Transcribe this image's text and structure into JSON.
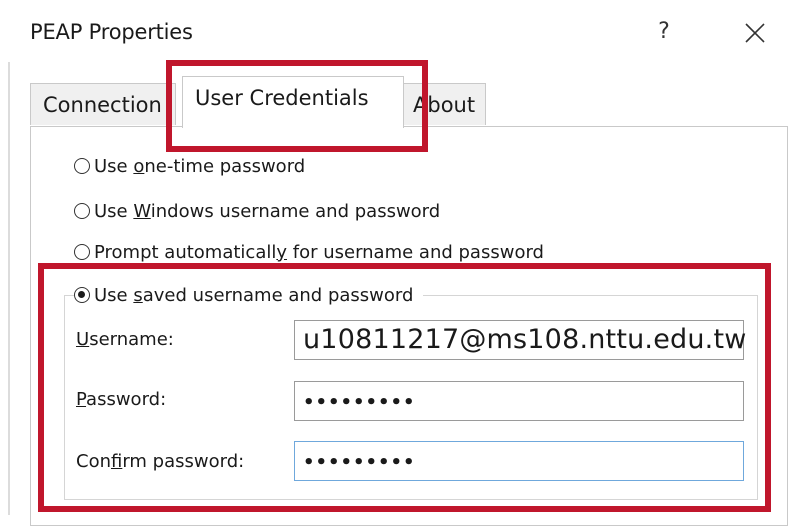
{
  "window": {
    "title": "PEAP Properties",
    "help_label": "?",
    "close_label": "✕"
  },
  "tabs": [
    {
      "label": "Connection",
      "active": false
    },
    {
      "label": "User Credentials",
      "active": true
    },
    {
      "label": "About",
      "active": false
    }
  ],
  "options": [
    {
      "pre": "Use ",
      "underline": "o",
      "post": "ne-time password",
      "checked": false
    },
    {
      "pre": "Use ",
      "underline": "W",
      "post": "indows username and password",
      "checked": false
    },
    {
      "pre": "Prompt automaticall",
      "underline": "y",
      "post": " for username and password",
      "checked": false
    },
    {
      "pre": "Use ",
      "underline": "s",
      "post": "aved username and password",
      "checked": true
    }
  ],
  "fields": {
    "username": {
      "label_underline": "U",
      "label_rest": "sername:",
      "value": "u10811217@ms108.nttu.edu.tw"
    },
    "password": {
      "label_underline": "P",
      "label_rest": "assword:",
      "value": "•••••••••"
    },
    "confirm": {
      "label_pre": "Con",
      "label_underline": "f",
      "label_rest": "irm password:",
      "value": "•••••••••"
    }
  },
  "colors": {
    "highlight": "#c0162c",
    "focus_border": "#6fa8dc"
  }
}
